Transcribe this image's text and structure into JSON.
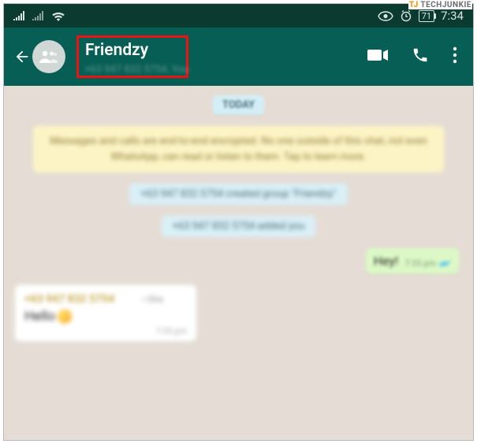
{
  "watermark": {
    "prefix": "TJ",
    "text": "TECHJUNKIE"
  },
  "status": {
    "battery": "71",
    "time": "7:34"
  },
  "header": {
    "title": "Friendzy",
    "subtitle": "+63 947 832 5754, You"
  },
  "chat": {
    "day_label": "TODAY",
    "encryption_notice": "Messages and calls are end-to-end encrypted. No one outside of this chat, not even WhatsApp, can read or listen to them. Tap to learn more.",
    "system_messages": [
      "+63 947 832 5754 created group \"Friendzy\"",
      "+63 947 832 5754 added you"
    ],
    "outgoing": {
      "text": "Hey!",
      "time": "7:33 pm"
    },
    "incoming": {
      "sender": "+63 947 832 5754",
      "tag": "~She",
      "text": "Hello",
      "time": "7:33 pm"
    }
  }
}
